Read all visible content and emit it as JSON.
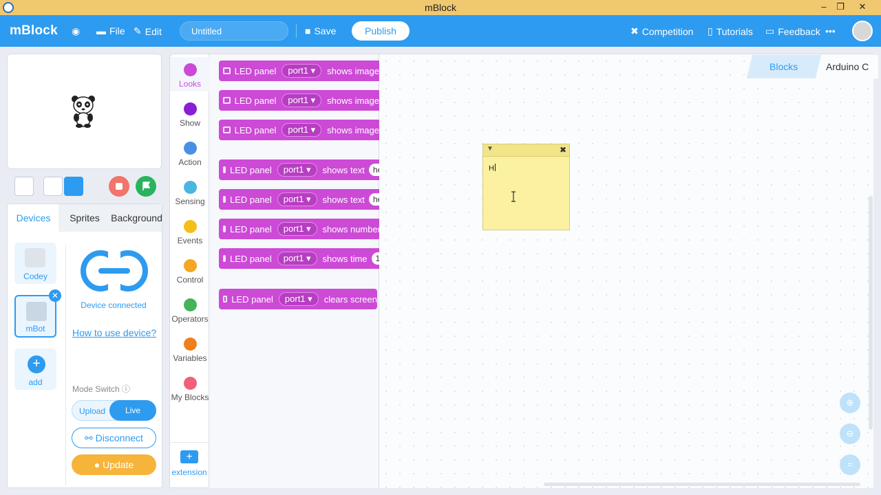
{
  "window": {
    "title": "mBlock"
  },
  "header": {
    "logo": "mBlock",
    "file": "File",
    "edit": "Edit",
    "project_name": "Untitled",
    "save": "Save",
    "publish": "Publish",
    "competition": "Competition",
    "tutorials": "Tutorials",
    "feedback": "Feedback",
    "more": "•••"
  },
  "left": {
    "tabs": [
      "Devices",
      "Sprites",
      "Background"
    ],
    "devices": [
      {
        "label": "Codey"
      },
      {
        "label": "mBot"
      },
      {
        "label": "add"
      }
    ],
    "device_connected": "Device connected",
    "how_to": "How to use device?",
    "mode_switch": "Mode Switch",
    "mode_upload": "Upload",
    "mode_live": "Live",
    "disconnect": "Disconnect",
    "update": "Update"
  },
  "categories": [
    {
      "label": "Looks",
      "color": "#cc4ad6"
    },
    {
      "label": "Show",
      "color": "#8a1fd6"
    },
    {
      "label": "Action",
      "color": "#4a90e2"
    },
    {
      "label": "Sensing",
      "color": "#4ab7e0"
    },
    {
      "label": "Events",
      "color": "#f5be1a"
    },
    {
      "label": "Control",
      "color": "#f5a623"
    },
    {
      "label": "Operators",
      "color": "#45b35a"
    },
    {
      "label": "Variables",
      "color": "#f07f1b"
    },
    {
      "label": "My Blocks",
      "color": "#f0607a"
    }
  ],
  "extension": "extension",
  "blocks": [
    {
      "label": "LED panel",
      "port": "port1 ▾",
      "action": "shows image",
      "pill": ""
    },
    {
      "label": "LED panel",
      "port": "port1 ▾",
      "action": "shows image",
      "pill": ""
    },
    {
      "label": "LED panel",
      "port": "port1 ▾",
      "action": "shows image",
      "pill": ""
    },
    {
      "label": "LED panel",
      "port": "port1 ▾",
      "action": "shows text",
      "pill": "he"
    },
    {
      "label": "LED panel",
      "port": "port1 ▾",
      "action": "shows text",
      "pill": "he"
    },
    {
      "label": "LED panel",
      "port": "port1 ▾",
      "action": "shows number",
      "pill": ""
    },
    {
      "label": "LED panel",
      "port": "port1 ▾",
      "action": "shows time",
      "pill": "1"
    },
    {
      "label": "LED panel",
      "port": "port1 ▾",
      "action": "clears screen",
      "pill": ""
    }
  ],
  "workspace": {
    "tab_blocks": "Blocks",
    "tab_code": "Arduino C",
    "note_text": "H"
  },
  "colors": {
    "accent": "#2d9bf0",
    "looks": "#cc4ad6",
    "note": "#fbf1a1",
    "title_bar": "#f0c870"
  }
}
